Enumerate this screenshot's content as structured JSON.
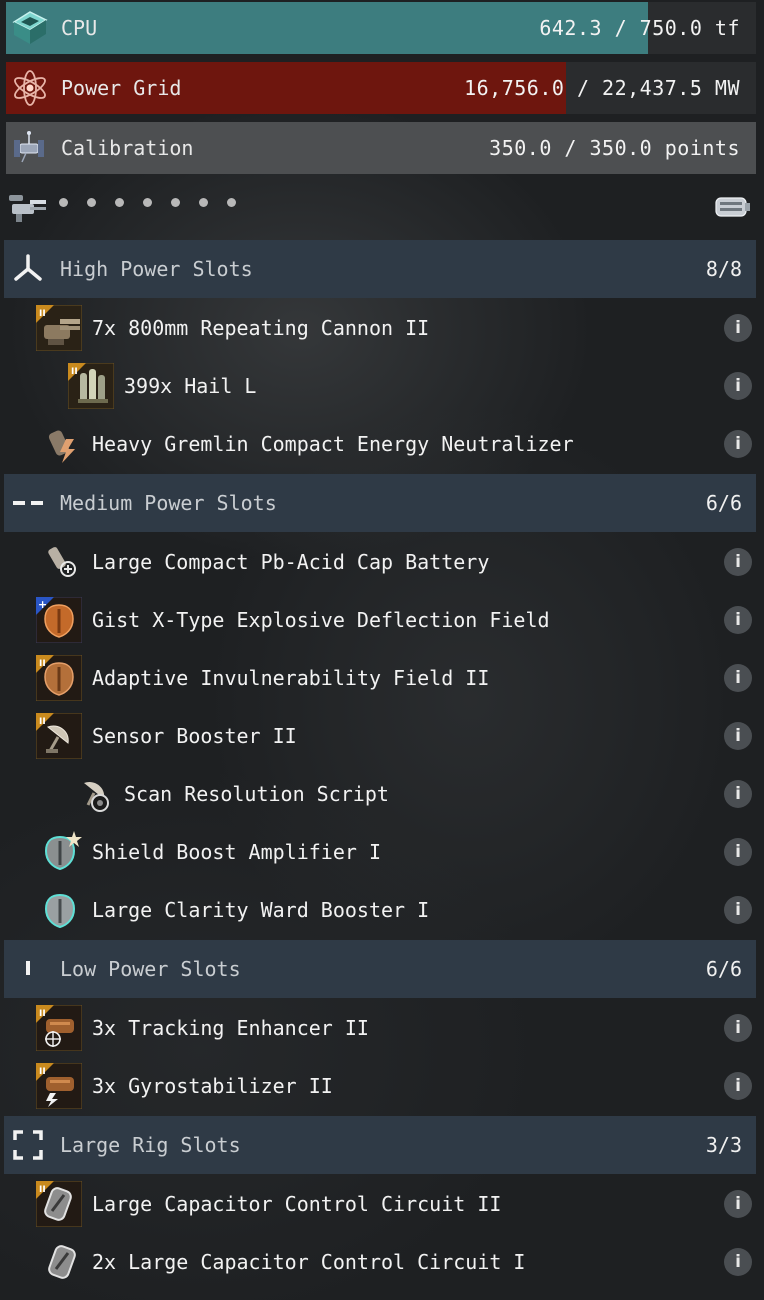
{
  "resources": {
    "cpu": {
      "label": "CPU",
      "value": "642.3 / 750.0 tf",
      "icon": "cpu-chip-icon",
      "used": 642.3,
      "max": 750.0,
      "color": "#3d7d7f"
    },
    "power": {
      "label": "Power Grid",
      "value": "16,756.0 / 22,437.5 MW",
      "icon": "power-grid-atom-icon",
      "used": 16756.0,
      "max": 22437.5,
      "color": "#6e160e"
    },
    "calibration": {
      "label": "Calibration",
      "value": "350.0 / 350.0 points",
      "icon": "calibration-satellite-icon",
      "used": 350.0,
      "max": 350.0,
      "color": "#4d4f51"
    }
  },
  "drones": {
    "dot_count": 7,
    "left_icon": "turret-icon",
    "right_icon": "drone-bay-icon"
  },
  "sections": {
    "high": {
      "title": "High Power Slots",
      "count": "8/8",
      "icon": "high-slot-icon"
    },
    "medium": {
      "title": "Medium Power Slots",
      "count": "6/6",
      "icon": "medium-slot-icon"
    },
    "low": {
      "title": "Low Power Slots",
      "count": "6/6",
      "icon": "low-slot-icon"
    },
    "rig": {
      "title": "Large Rig Slots",
      "count": "3/3",
      "icon": "rig-slot-icon"
    }
  },
  "modules": {
    "high": [
      {
        "name": "7x 800mm Repeating Cannon II",
        "icon": "artillery-cannon-icon",
        "tech2": true
      },
      {
        "name": "399x Hail L",
        "icon": "ammo-icon",
        "tech2": true
      },
      {
        "name": "Heavy Gremlin Compact Energy Neutralizer",
        "icon": "energy-neutralizer-icon",
        "tech2": false
      }
    ],
    "medium": [
      {
        "name": "Large Compact Pb-Acid Cap Battery",
        "icon": "cap-battery-icon",
        "tech2": false
      },
      {
        "name": "Gist X-Type Explosive Deflection Field",
        "icon": "shield-hardener-icon",
        "tech2": false,
        "faction": true
      },
      {
        "name": "Adaptive Invulnerability Field II",
        "icon": "shield-hardener-icon",
        "tech2": true
      },
      {
        "name": "Sensor Booster II",
        "icon": "sensor-booster-icon",
        "tech2": true
      },
      {
        "name": "Scan Resolution Script",
        "icon": "script-icon",
        "tech2": false
      },
      {
        "name": "Shield Boost Amplifier I",
        "icon": "shield-amplifier-icon",
        "tech2": false
      },
      {
        "name": "Large Clarity Ward Booster I",
        "icon": "shield-booster-icon",
        "tech2": false
      }
    ],
    "low": [
      {
        "name": "3x Tracking Enhancer II",
        "icon": "tracking-enhancer-icon",
        "tech2": true
      },
      {
        "name": "3x Gyrostabilizer II",
        "icon": "gyrostabilizer-icon",
        "tech2": true
      }
    ],
    "rig": [
      {
        "name": "Large Capacitor Control Circuit II",
        "icon": "capacitor-rig-icon",
        "tech2": true
      },
      {
        "name": "2x Large Capacitor Control Circuit I",
        "icon": "capacitor-rig-icon",
        "tech2": false
      }
    ]
  },
  "info_glyph": "i"
}
